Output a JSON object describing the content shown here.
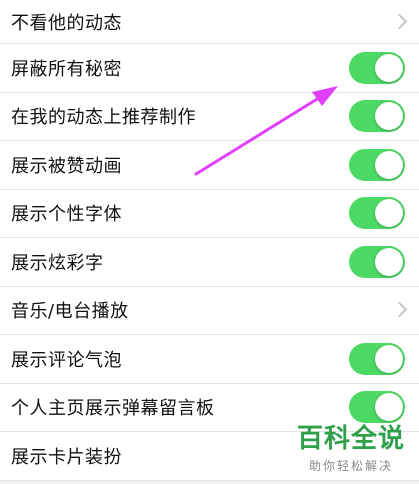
{
  "rows": [
    {
      "label": "不看他的动态",
      "control": "chevron"
    },
    {
      "label": "屏蔽所有秘密",
      "control": "toggle",
      "on": true
    },
    {
      "label": "在我的动态上推荐制作",
      "control": "toggle",
      "on": true
    },
    {
      "label": "展示被赞动画",
      "control": "toggle",
      "on": true
    },
    {
      "label": "展示个性字体",
      "control": "toggle",
      "on": true
    },
    {
      "label": "展示炫彩字",
      "control": "toggle",
      "on": true
    },
    {
      "label": "音乐/电台播放",
      "control": "chevron"
    },
    {
      "label": "展示评论气泡",
      "control": "toggle",
      "on": true
    },
    {
      "label": "个人主页展示弹幕留言板",
      "control": "toggle",
      "on": true
    },
    {
      "label": "展示卡片装扮",
      "control": "none"
    }
  ],
  "watermark": {
    "brand": "百科全说",
    "slogan": "助你轻松解决"
  },
  "colors": {
    "toggle_on": "#4cd964",
    "annotation_arrow": "#e040fb",
    "brand": "#2ea049"
  }
}
